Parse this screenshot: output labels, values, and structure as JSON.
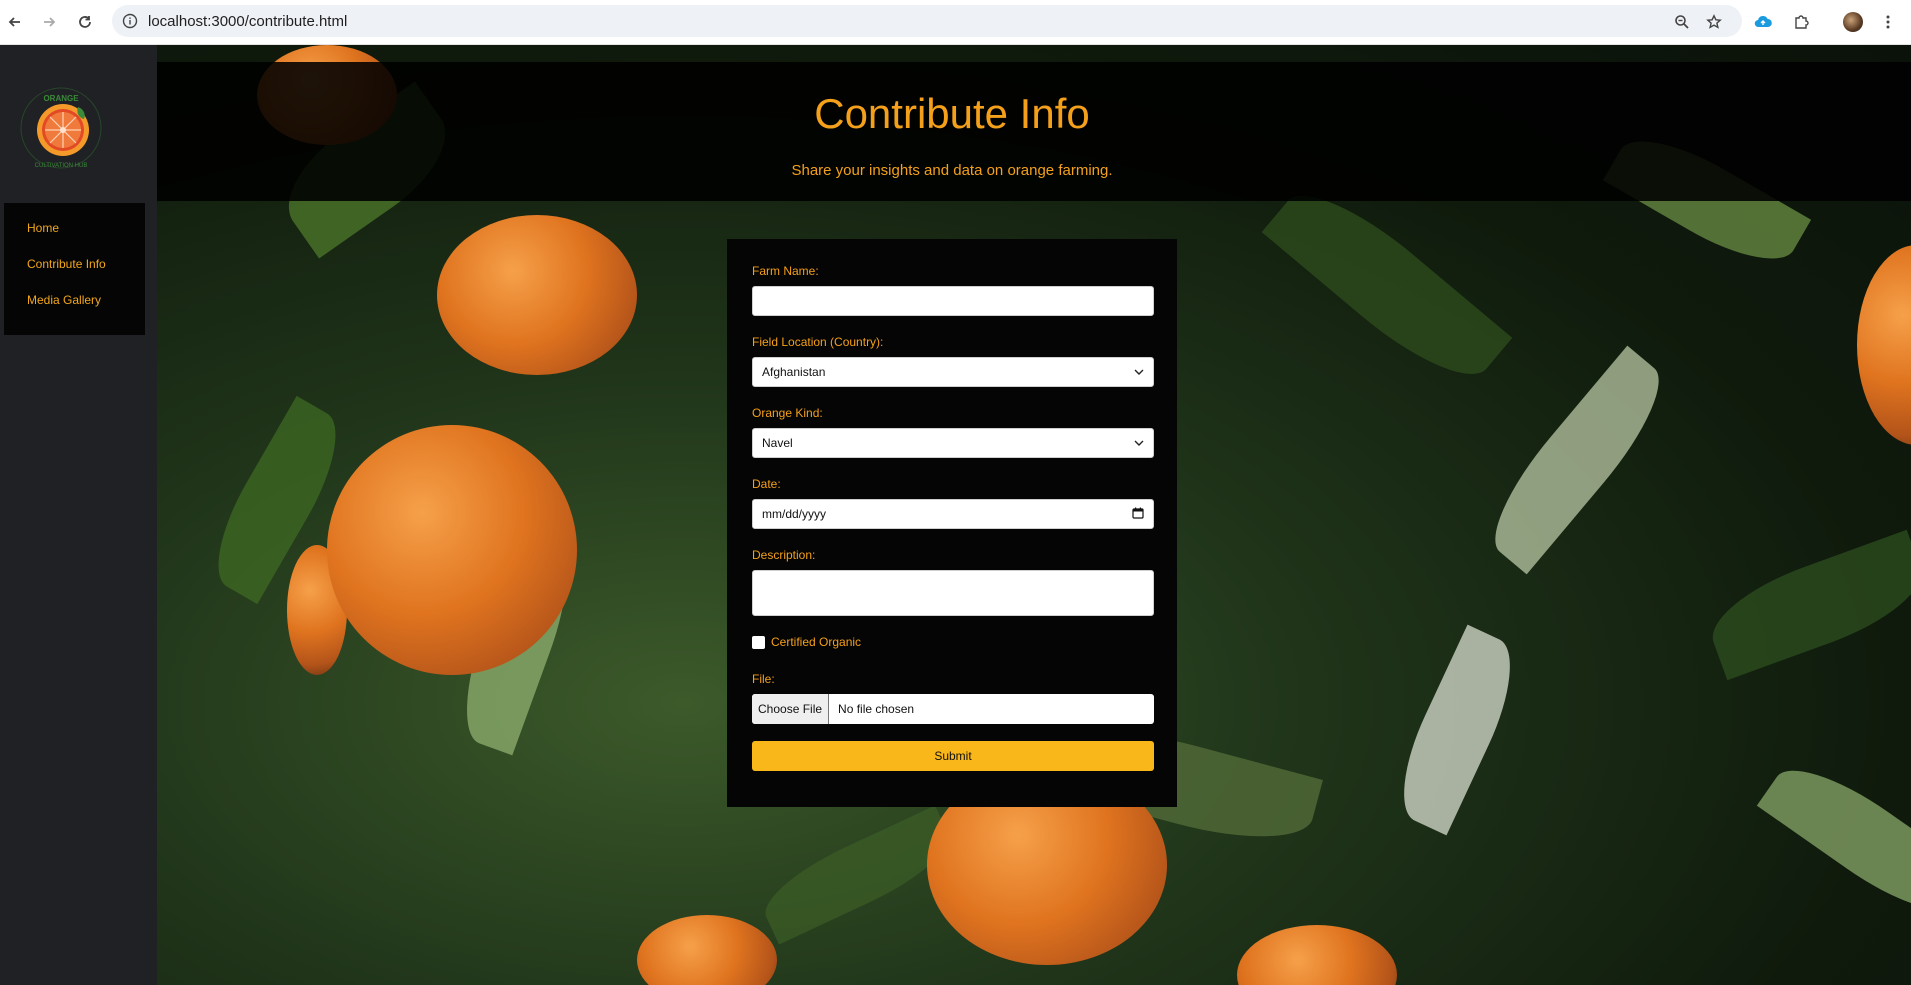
{
  "browser": {
    "url": "localhost:3000/contribute.html"
  },
  "sidebar": {
    "logo_text": "ORANGE CULTIVATION HUB",
    "items": [
      {
        "label": "Home"
      },
      {
        "label": "Contribute Info"
      },
      {
        "label": "Media Gallery"
      }
    ]
  },
  "hero": {
    "title": "Contribute Info",
    "subtitle": "Share your insights and data on orange farming."
  },
  "form": {
    "farm_name_label": "Farm Name:",
    "farm_name_value": "",
    "location_label": "Field Location (Country):",
    "location_value": "Afghanistan",
    "kind_label": "Orange Kind:",
    "kind_value": "Navel",
    "date_label": "Date:",
    "date_placeholder": "mm/dd/yyyy",
    "description_label": "Description:",
    "description_value": "",
    "organic_label": "Certified Organic",
    "organic_checked": false,
    "file_label": "File:",
    "file_button": "Choose File",
    "file_status": "No file chosen",
    "submit_label": "Submit"
  },
  "colors": {
    "accent": "#f4a01a",
    "submit": "#f9b719",
    "sidebar_bg": "#202125",
    "panel_bg": "#050505"
  }
}
